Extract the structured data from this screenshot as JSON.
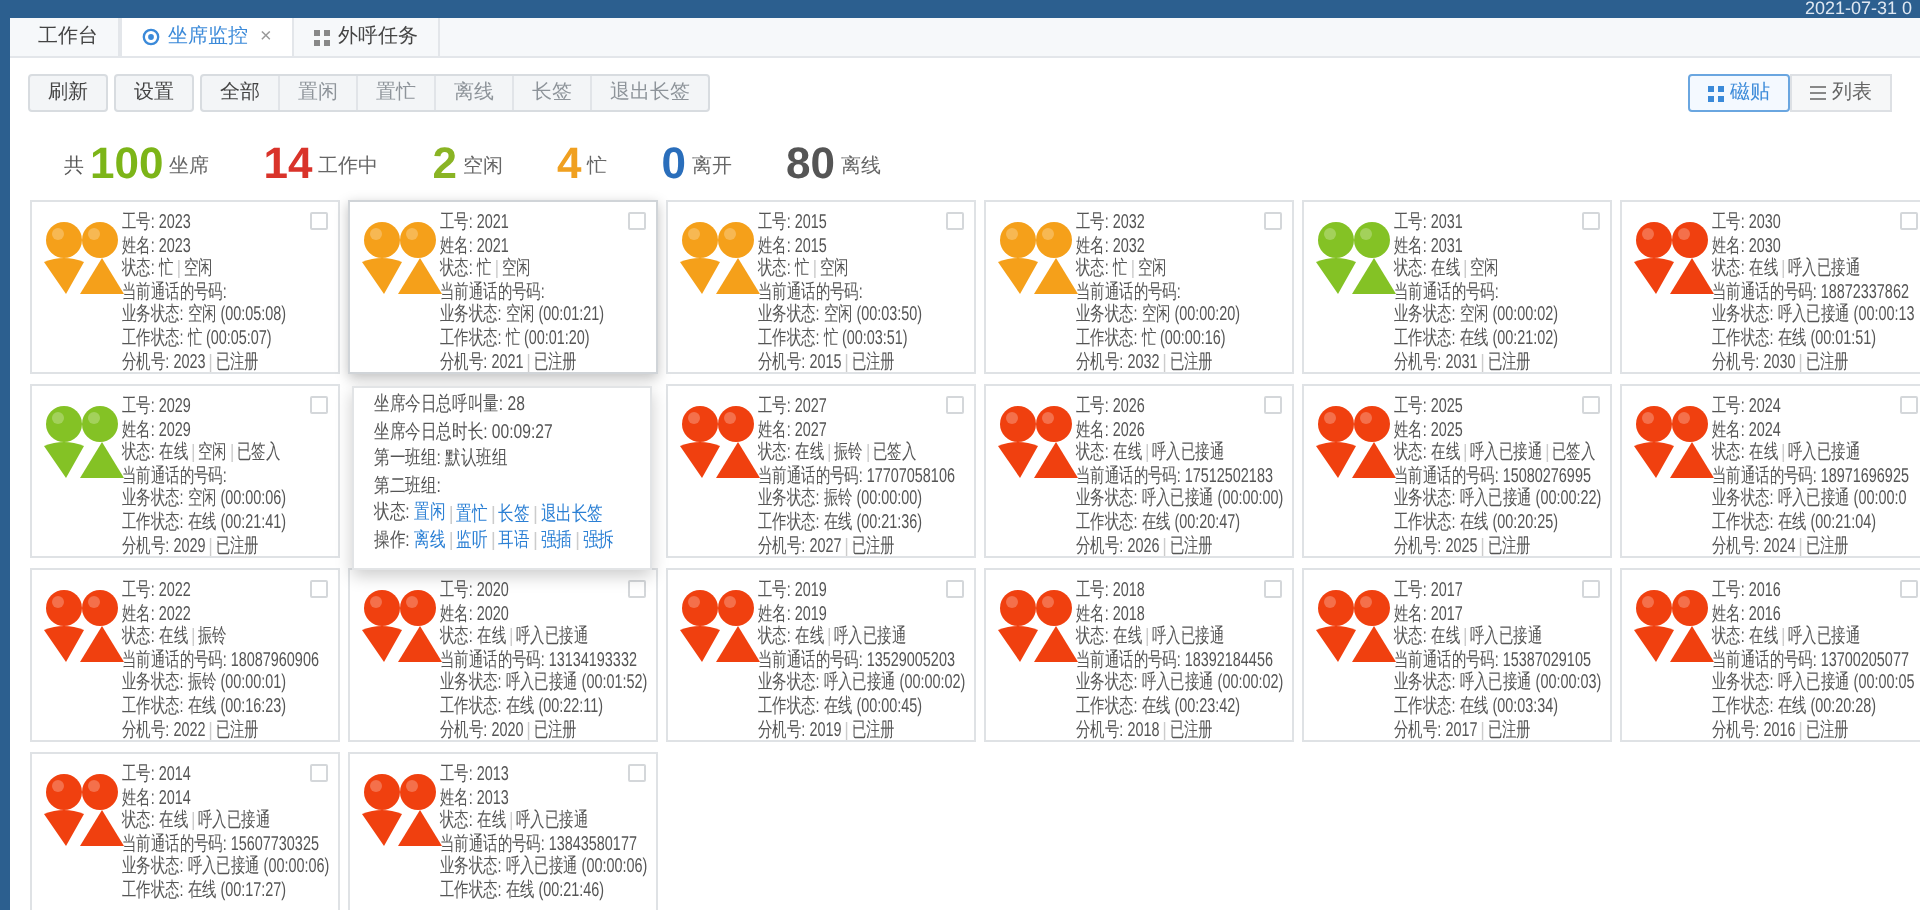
{
  "header": {
    "clock": "2021-07-31 0"
  },
  "tabs": [
    {
      "label": "工作台",
      "selected": false
    },
    {
      "label": "坐席监控",
      "selected": true,
      "close_label": "×"
    },
    {
      "label": "外呼任务",
      "selected": false
    }
  ],
  "toolbar": {
    "groups": [
      [
        {
          "label": "刷新",
          "disabled": false
        }
      ],
      [
        {
          "label": "设置",
          "disabled": false
        }
      ],
      [
        {
          "label": "全部",
          "disabled": false
        },
        {
          "label": "置闲",
          "disabled": true
        },
        {
          "label": "置忙",
          "disabled": true
        },
        {
          "label": "离线",
          "disabled": true
        },
        {
          "label": "长签",
          "disabled": true
        },
        {
          "label": "退出长签",
          "disabled": true
        }
      ]
    ]
  },
  "view_switch": [
    {
      "label": "磁贴",
      "selected": true
    },
    {
      "label": "列表",
      "selected": false
    }
  ],
  "summary": [
    {
      "prefix": "共",
      "value": "100",
      "label": "坐席",
      "color": "#7cb518"
    },
    {
      "value": "14",
      "label": "工作中",
      "color": "#d9332a"
    },
    {
      "value": "2",
      "label": "空闲",
      "color": "#8ab424"
    },
    {
      "value": "4",
      "label": "忙",
      "color": "#f0a020"
    },
    {
      "value": "0",
      "label": "离开",
      "color": "#2a6ebb"
    },
    {
      "value": "80",
      "label": "离线",
      "color": "#555555"
    }
  ],
  "cards": [
    {
      "kind": "agent",
      "color": "#f5a01a",
      "highlighted": false,
      "checked": false,
      "fields": [
        {
          "label": "工号:",
          "value": "2023"
        },
        {
          "label": "姓名:",
          "value": "2023"
        },
        {
          "label": "状态:",
          "parts": [
            "忙",
            "空闲"
          ]
        },
        {
          "label": "当前通话的号码:"
        },
        {
          "label": "业务状态:",
          "value": "空闲 (00:05:08)"
        },
        {
          "label": "工作状态:",
          "value": "忙 (00:05:07)"
        },
        {
          "label": "分机号:",
          "parts": [
            "2023",
            "已注册"
          ]
        }
      ]
    },
    {
      "kind": "agent",
      "color": "#f5a01a",
      "highlighted": true,
      "checked": false,
      "fields": [
        {
          "label": "工号:",
          "value": "2021"
        },
        {
          "label": "姓名:",
          "value": "2021"
        },
        {
          "label": "状态:",
          "parts": [
            "忙",
            "空闲"
          ]
        },
        {
          "label": "当前通话的号码:"
        },
        {
          "label": "业务状态:",
          "value": "空闲 (00:01:21)"
        },
        {
          "label": "工作状态:",
          "value": "忙 (00:01:20)"
        },
        {
          "label": "分机号:",
          "parts": [
            "2021",
            "已注册"
          ]
        }
      ]
    },
    {
      "kind": "agent",
      "color": "#f5a01a",
      "highlighted": false,
      "checked": false,
      "fields": [
        {
          "label": "工号:",
          "value": "2015"
        },
        {
          "label": "姓名:",
          "value": "2015"
        },
        {
          "label": "状态:",
          "parts": [
            "忙",
            "空闲"
          ]
        },
        {
          "label": "当前通话的号码:"
        },
        {
          "label": "业务状态:",
          "value": "空闲 (00:03:50)"
        },
        {
          "label": "工作状态:",
          "value": "忙 (00:03:51)"
        },
        {
          "label": "分机号:",
          "parts": [
            "2015",
            "已注册"
          ]
        }
      ]
    },
    {
      "kind": "agent",
      "color": "#f5a01a",
      "highlighted": false,
      "checked": false,
      "fields": [
        {
          "label": "工号:",
          "value": "2032"
        },
        {
          "label": "姓名:",
          "value": "2032"
        },
        {
          "label": "状态:",
          "parts": [
            "忙",
            "空闲"
          ]
        },
        {
          "label": "当前通话的号码:"
        },
        {
          "label": "业务状态:",
          "value": "空闲 (00:00:20)"
        },
        {
          "label": "工作状态:",
          "value": "忙 (00:00:16)"
        },
        {
          "label": "分机号:",
          "parts": [
            "2032",
            "已注册"
          ]
        }
      ]
    },
    {
      "kind": "agent",
      "color": "#84c225",
      "highlighted": false,
      "checked": false,
      "fields": [
        {
          "label": "工号:",
          "value": "2031"
        },
        {
          "label": "姓名:",
          "value": "2031"
        },
        {
          "label": "状态:",
          "parts": [
            "在线",
            "空闲"
          ]
        },
        {
          "label": "当前通话的号码:"
        },
        {
          "label": "业务状态:",
          "value": "空闲 (00:00:02)"
        },
        {
          "label": "工作状态:",
          "value": "在线 (00:21:02)"
        },
        {
          "label": "分机号:",
          "parts": [
            "2031",
            "已注册"
          ]
        }
      ]
    },
    {
      "kind": "agent",
      "color": "#f0400f",
      "highlighted": false,
      "checked": false,
      "fields": [
        {
          "label": "工号:",
          "value": "2030"
        },
        {
          "label": "姓名:",
          "value": "2030"
        },
        {
          "label": "状态:",
          "parts": [
            "在线",
            "呼入已接通"
          ]
        },
        {
          "label": "当前通话的号码:",
          "value": "18872337862"
        },
        {
          "label": "业务状态:",
          "value": "呼入已接通 (00:00:13"
        },
        {
          "label": "工作状态:",
          "value": "在线 (00:01:51)"
        },
        {
          "label": "分机号:",
          "parts": [
            "2030",
            "已注册"
          ]
        }
      ]
    },
    {
      "kind": "agent",
      "color": "#84c225",
      "highlighted": false,
      "checked": false,
      "fields": [
        {
          "label": "工号:",
          "value": "2029"
        },
        {
          "label": "姓名:",
          "value": "2029"
        },
        {
          "label": "状态:",
          "parts": [
            "在线",
            "空闲",
            "已签入"
          ]
        },
        {
          "label": "当前通话的号码:"
        },
        {
          "label": "业务状态:",
          "value": "空闲 (00:00:06)"
        },
        {
          "label": "工作状态:",
          "value": "在线 (00:21:41)"
        },
        {
          "label": "分机号:",
          "parts": [
            "2029",
            "已注册"
          ]
        }
      ]
    },
    {
      "kind": "popup",
      "lines": [
        {
          "label": "坐席今日总呼叫量:",
          "value": "28"
        },
        {
          "label": "坐席今日总时长:",
          "value": "00:09:27"
        },
        {
          "label": "第一班组:",
          "value": "默认班组"
        },
        {
          "label": "第二班组:"
        },
        {
          "label": "状态:",
          "links": [
            "置闲",
            "置忙",
            "长签",
            "退出长签"
          ]
        },
        {
          "label": "操作:",
          "links": [
            "离线",
            "监听",
            "耳语",
            "强插",
            "强拆"
          ]
        }
      ]
    },
    {
      "kind": "agent",
      "color": "#f0400f",
      "highlighted": false,
      "checked": false,
      "fields": [
        {
          "label": "工号:",
          "value": "2027"
        },
        {
          "label": "姓名:",
          "value": "2027"
        },
        {
          "label": "状态:",
          "parts": [
            "在线",
            "振铃",
            "已签入"
          ]
        },
        {
          "label": "当前通话的号码:",
          "value": "17707058106"
        },
        {
          "label": "业务状态:",
          "value": "振铃 (00:00:00)"
        },
        {
          "label": "工作状态:",
          "value": "在线 (00:21:36)"
        },
        {
          "label": "分机号:",
          "parts": [
            "2027",
            "已注册"
          ]
        }
      ]
    },
    {
      "kind": "agent",
      "color": "#f0400f",
      "highlighted": false,
      "checked": false,
      "fields": [
        {
          "label": "工号:",
          "value": "2026"
        },
        {
          "label": "姓名:",
          "value": "2026"
        },
        {
          "label": "状态:",
          "parts": [
            "在线",
            "呼入已接通"
          ]
        },
        {
          "label": "当前通话的号码:",
          "value": "17512502183"
        },
        {
          "label": "业务状态:",
          "value": "呼入已接通 (00:00:00)"
        },
        {
          "label": "工作状态:",
          "value": "在线 (00:20:47)"
        },
        {
          "label": "分机号:",
          "parts": [
            "2026",
            "已注册"
          ]
        }
      ]
    },
    {
      "kind": "agent",
      "color": "#f0400f",
      "highlighted": false,
      "checked": false,
      "fields": [
        {
          "label": "工号:",
          "value": "2025"
        },
        {
          "label": "姓名:",
          "value": "2025"
        },
        {
          "label": "状态:",
          "parts": [
            "在线",
            "呼入已接通",
            "已签入"
          ]
        },
        {
          "label": "当前通话的号码:",
          "value": "15080276995"
        },
        {
          "label": "业务状态:",
          "value": "呼入已接通 (00:00:22)"
        },
        {
          "label": "工作状态:",
          "value": "在线 (00:20:25)"
        },
        {
          "label": "分机号:",
          "parts": [
            "2025",
            "已注册"
          ]
        }
      ]
    },
    {
      "kind": "agent",
      "color": "#f0400f",
      "highlighted": false,
      "checked": false,
      "fields": [
        {
          "label": "工号:",
          "value": "2024"
        },
        {
          "label": "姓名:",
          "value": "2024"
        },
        {
          "label": "状态:",
          "parts": [
            "在线",
            "呼入已接通"
          ]
        },
        {
          "label": "当前通话的号码:",
          "value": "18971696925"
        },
        {
          "label": "业务状态:",
          "value": "呼入已接通 (00:00:0"
        },
        {
          "label": "工作状态:",
          "value": "在线 (00:21:04)"
        },
        {
          "label": "分机号:",
          "parts": [
            "2024",
            "已注册"
          ]
        }
      ]
    },
    {
      "kind": "agent",
      "color": "#f0400f",
      "highlighted": false,
      "checked": false,
      "fields": [
        {
          "label": "工号:",
          "value": "2022"
        },
        {
          "label": "姓名:",
          "value": "2022"
        },
        {
          "label": "状态:",
          "parts": [
            "在线",
            "振铃"
          ]
        },
        {
          "label": "当前通话的号码:",
          "value": "18087960906"
        },
        {
          "label": "业务状态:",
          "value": "振铃 (00:00:01)"
        },
        {
          "label": "工作状态:",
          "value": "在线 (00:16:23)"
        },
        {
          "label": "分机号:",
          "parts": [
            "2022",
            "已注册"
          ]
        }
      ]
    },
    {
      "kind": "agent",
      "color": "#f0400f",
      "highlighted": false,
      "checked": false,
      "fields": [
        {
          "label": "工号:",
          "value": "2020"
        },
        {
          "label": "姓名:",
          "value": "2020"
        },
        {
          "label": "状态:",
          "parts": [
            "在线",
            "呼入已接通"
          ]
        },
        {
          "label": "当前通话的号码:",
          "value": "13134193332"
        },
        {
          "label": "业务状态:",
          "value": "呼入已接通 (00:01:52)"
        },
        {
          "label": "工作状态:",
          "value": "在线 (00:22:11)"
        },
        {
          "label": "分机号:",
          "parts": [
            "2020",
            "已注册"
          ]
        }
      ]
    },
    {
      "kind": "agent",
      "color": "#f0400f",
      "highlighted": false,
      "checked": false,
      "fields": [
        {
          "label": "工号:",
          "value": "2019"
        },
        {
          "label": "姓名:",
          "value": "2019"
        },
        {
          "label": "状态:",
          "parts": [
            "在线",
            "呼入已接通"
          ]
        },
        {
          "label": "当前通话的号码:",
          "value": "13529005203"
        },
        {
          "label": "业务状态:",
          "value": "呼入已接通 (00:00:02)"
        },
        {
          "label": "工作状态:",
          "value": "在线 (00:00:45)"
        },
        {
          "label": "分机号:",
          "parts": [
            "2019",
            "已注册"
          ]
        }
      ]
    },
    {
      "kind": "agent",
      "color": "#f0400f",
      "highlighted": false,
      "checked": false,
      "fields": [
        {
          "label": "工号:",
          "value": "2018"
        },
        {
          "label": "姓名:",
          "value": "2018"
        },
        {
          "label": "状态:",
          "parts": [
            "在线",
            "呼入已接通"
          ]
        },
        {
          "label": "当前通话的号码:",
          "value": "18392184456"
        },
        {
          "label": "业务状态:",
          "value": "呼入已接通 (00:00:02)"
        },
        {
          "label": "工作状态:",
          "value": "在线 (00:23:42)"
        },
        {
          "label": "分机号:",
          "parts": [
            "2018",
            "已注册"
          ]
        }
      ]
    },
    {
      "kind": "agent",
      "color": "#f0400f",
      "highlighted": false,
      "checked": false,
      "fields": [
        {
          "label": "工号:",
          "value": "2017"
        },
        {
          "label": "姓名:",
          "value": "2017"
        },
        {
          "label": "状态:",
          "parts": [
            "在线",
            "呼入已接通"
          ]
        },
        {
          "label": "当前通话的号码:",
          "value": "15387029105"
        },
        {
          "label": "业务状态:",
          "value": "呼入已接通 (00:00:03)"
        },
        {
          "label": "工作状态:",
          "value": "在线 (00:03:34)"
        },
        {
          "label": "分机号:",
          "parts": [
            "2017",
            "已注册"
          ]
        }
      ]
    },
    {
      "kind": "agent",
      "color": "#f0400f",
      "highlighted": false,
      "checked": false,
      "fields": [
        {
          "label": "工号:",
          "value": "2016"
        },
        {
          "label": "姓名:",
          "value": "2016"
        },
        {
          "label": "状态:",
          "parts": [
            "在线",
            "呼入已接通"
          ]
        },
        {
          "label": "当前通话的号码:",
          "value": "13700205077"
        },
        {
          "label": "业务状态:",
          "value": "呼入已接通 (00:00:05"
        },
        {
          "label": "工作状态:",
          "value": "在线 (00:20:28)"
        },
        {
          "label": "分机号:",
          "parts": [
            "2016",
            "已注册"
          ]
        }
      ]
    },
    {
      "kind": "agent",
      "color": "#f0400f",
      "highlighted": false,
      "checked": false,
      "fields": [
        {
          "label": "工号:",
          "value": "2014"
        },
        {
          "label": "姓名:",
          "value": "2014"
        },
        {
          "label": "状态:",
          "parts": [
            "在线",
            "呼入已接通"
          ]
        },
        {
          "label": "当前通话的号码:",
          "value": "15607730325"
        },
        {
          "label": "业务状态:",
          "value": "呼入已接通 (00:00:06)"
        },
        {
          "label": "工作状态:",
          "value": "在线 (00:17:27)"
        }
      ]
    },
    {
      "kind": "agent",
      "color": "#f0400f",
      "highlighted": false,
      "checked": false,
      "fields": [
        {
          "label": "工号:",
          "value": "2013"
        },
        {
          "label": "姓名:",
          "value": "2013"
        },
        {
          "label": "状态:",
          "parts": [
            "在线",
            "呼入已接通"
          ]
        },
        {
          "label": "当前通话的号码:",
          "value": "13843580177"
        },
        {
          "label": "业务状态:",
          "value": "呼入已接通 (00:00:06)"
        },
        {
          "label": "工作状态:",
          "value": "在线 (00:21:46)"
        }
      ]
    }
  ]
}
